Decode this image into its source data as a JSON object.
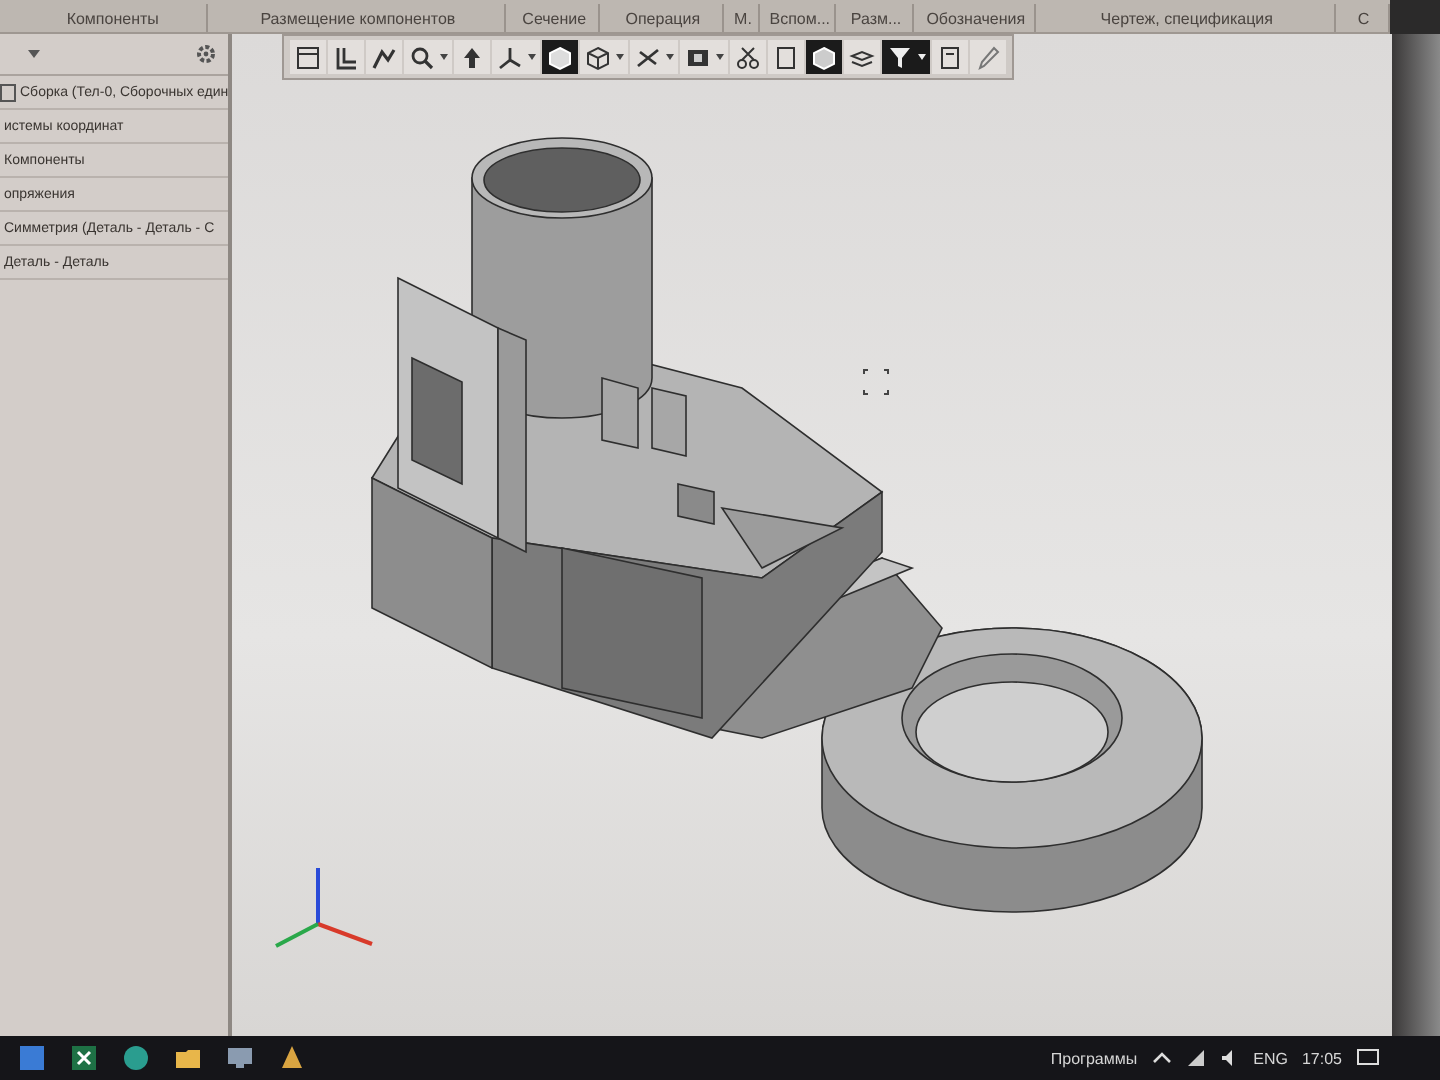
{
  "ribbon": {
    "groups": [
      {
        "label": "Компоненты"
      },
      {
        "label": "Размещение компонентов"
      },
      {
        "label": "Сечение"
      },
      {
        "label": "Операция"
      },
      {
        "label": "М."
      },
      {
        "label": "Вспом..."
      },
      {
        "label": "Разм..."
      },
      {
        "label": "Обозначения"
      },
      {
        "label": "Чертеж, спецификация"
      },
      {
        "label": "С"
      }
    ]
  },
  "toolbar": {
    "buttons": [
      {
        "selected": false,
        "dropdown": false
      },
      {
        "selected": false,
        "dropdown": false
      },
      {
        "selected": false,
        "dropdown": false
      },
      {
        "selected": false,
        "dropdown": true
      },
      {
        "selected": false,
        "dropdown": false
      },
      {
        "selected": false,
        "dropdown": true
      },
      {
        "selected": true,
        "dropdown": false
      },
      {
        "selected": false,
        "dropdown": true
      },
      {
        "selected": false,
        "dropdown": true
      },
      {
        "selected": false,
        "dropdown": true
      },
      {
        "selected": false,
        "dropdown": false
      },
      {
        "selected": false,
        "dropdown": false
      },
      {
        "selected": true,
        "dropdown": false
      },
      {
        "selected": false,
        "dropdown": false
      },
      {
        "selected": true,
        "dropdown": true
      },
      {
        "selected": false,
        "dropdown": false
      },
      {
        "selected": false,
        "dropdown": false
      }
    ]
  },
  "tree": {
    "items": [
      {
        "label": "Сборка (Тел-0, Сборочных един",
        "children": [
          {
            "label": "истемы координат"
          },
          {
            "label": "Компоненты"
          },
          {
            "label": "опряжения"
          },
          {
            "label": "Симметрия (Деталь  -  Деталь  -  С"
          },
          {
            "label": "Деталь - Деталь"
          }
        ]
      }
    ]
  },
  "taskbar": {
    "tray_label": "Программы",
    "language": "ENG",
    "time": "17:05"
  }
}
